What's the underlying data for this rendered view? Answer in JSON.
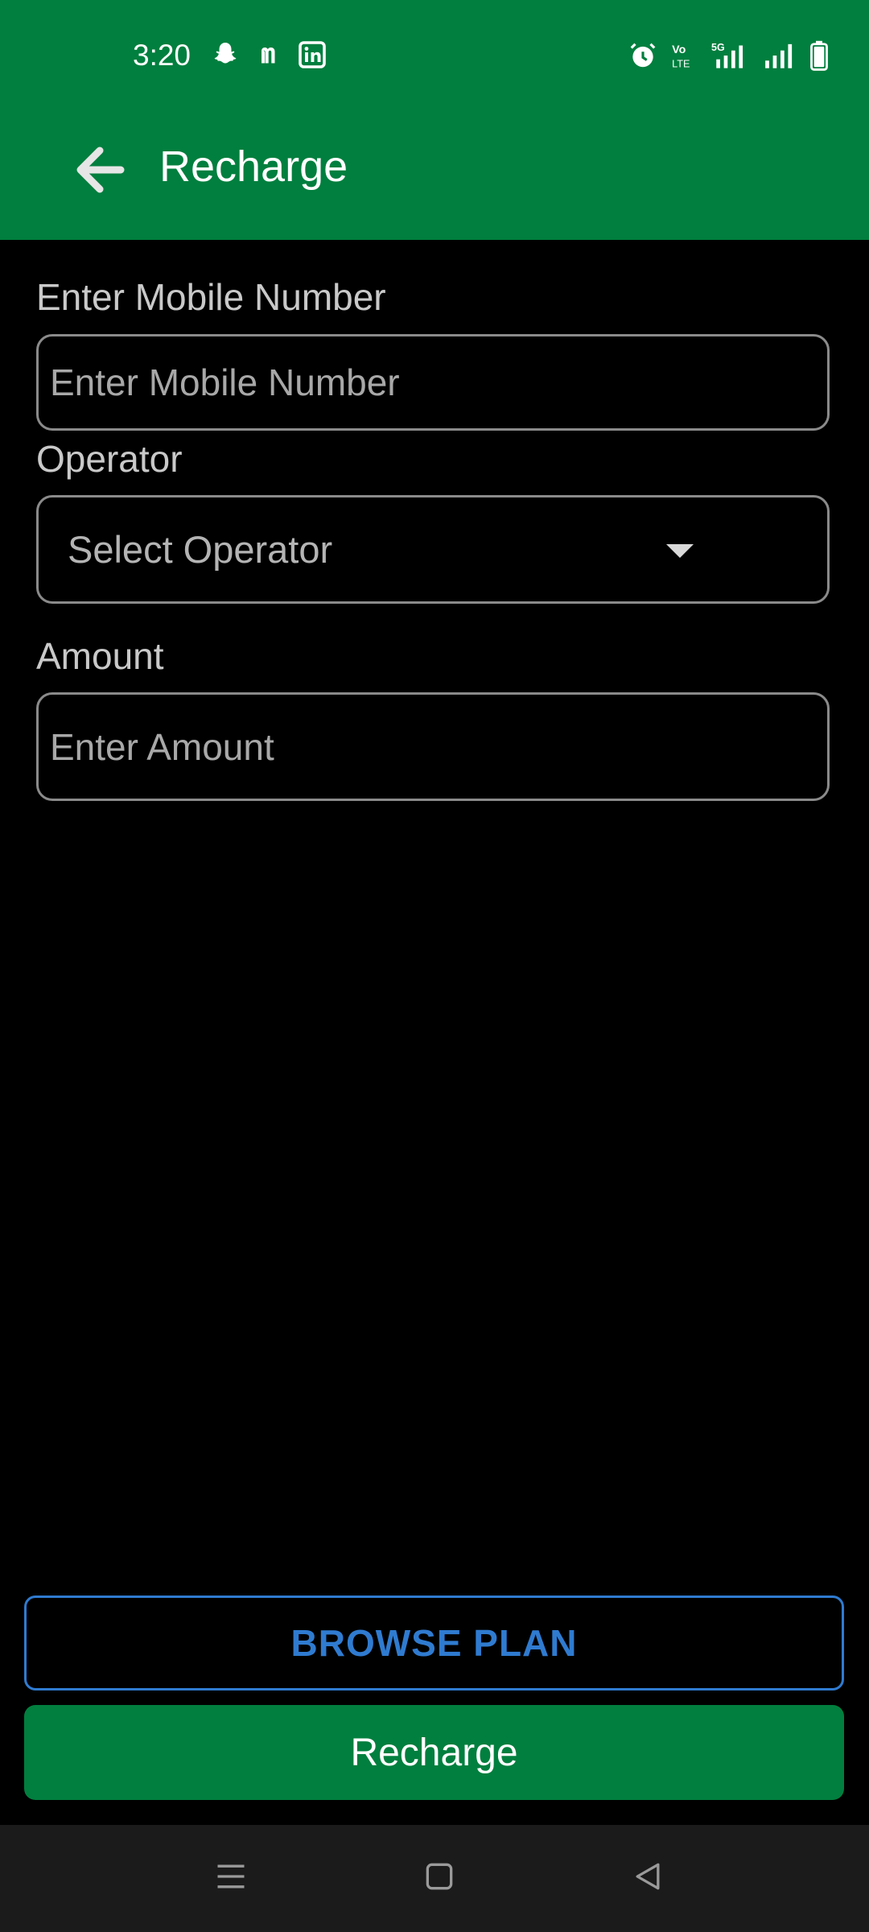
{
  "status_bar": {
    "time": "3:20",
    "left_icons": [
      "snapchat-icon",
      "medium-icon",
      "linkedin-icon"
    ],
    "right_icons": [
      "alarm-icon",
      "volte-icon",
      "5g-signal-icon",
      "signal-icon",
      "battery-icon"
    ],
    "volte_text": "Vo LTE",
    "network": "5G"
  },
  "app_bar": {
    "title": "Recharge",
    "back_icon": "arrow-left-icon"
  },
  "form": {
    "mobile": {
      "label": "Enter Mobile Number",
      "placeholder": "Enter Mobile Number",
      "value": ""
    },
    "operator": {
      "label": "Operator",
      "selected": "Select Operator"
    },
    "amount": {
      "label": "Amount",
      "placeholder": "Enter Amount",
      "value": ""
    }
  },
  "actions": {
    "browse_plan": "BROWSE PLAN",
    "recharge": "Recharge"
  },
  "nav_bar": {
    "items": [
      "menu-icon",
      "home-icon",
      "back-icon"
    ]
  },
  "colors": {
    "primary_green": "#017f3e",
    "accent_blue": "#2f7bd0",
    "background": "#000000"
  }
}
